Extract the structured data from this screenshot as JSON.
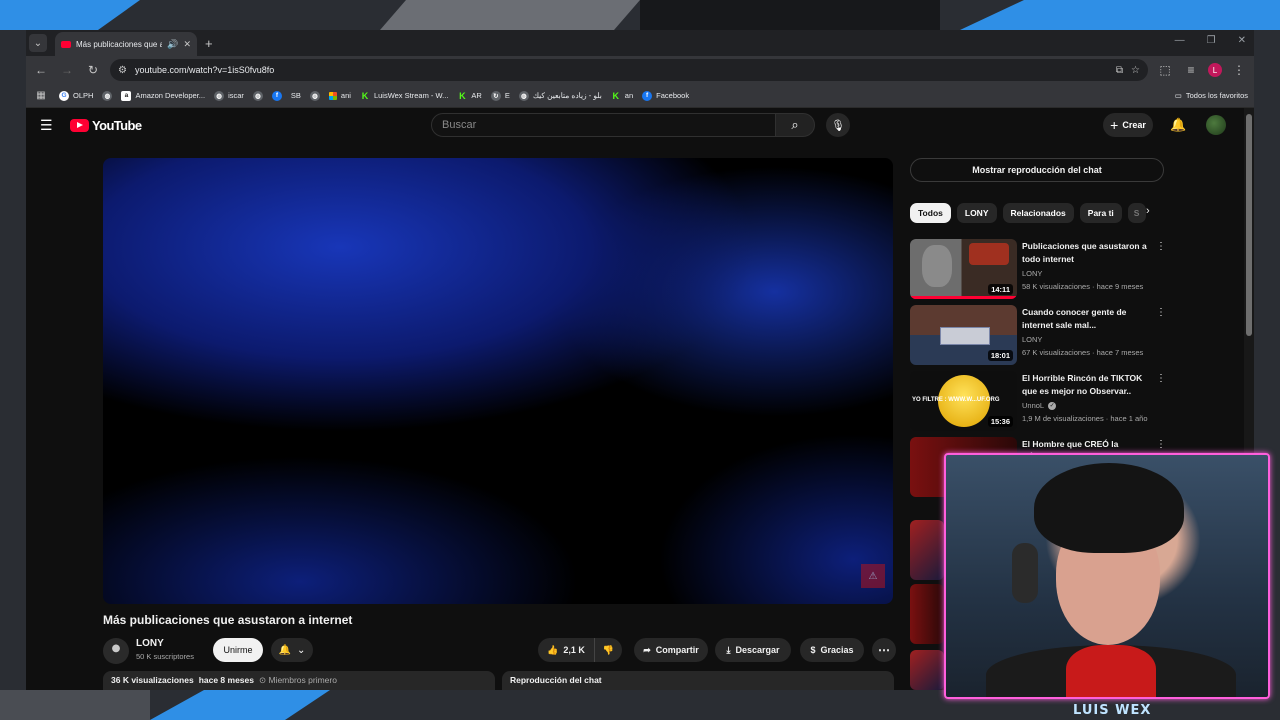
{
  "browser": {
    "tab": {
      "title": "Más publicaciones que asustaron a internet"
    },
    "url": "youtube.com/watch?v=1isS0fvu8fo",
    "profile_initial": "L",
    "bookmarks": [
      {
        "icon": "google-icon",
        "label": "OLPH"
      },
      {
        "icon": "globe-icon",
        "label": ""
      },
      {
        "icon": "amazon-icon",
        "label": "Amazon Developer..."
      },
      {
        "icon": "globe-icon",
        "label": "iscar"
      },
      {
        "icon": "globe-icon",
        "label": ""
      },
      {
        "icon": "facebook-icon",
        "label": ""
      },
      {
        "icon": "youtube-icon",
        "label": "SB"
      },
      {
        "icon": "globe-icon",
        "label": ""
      },
      {
        "icon": "microsoft-icon",
        "label": "ani"
      },
      {
        "icon": "kick-icon",
        "label": "LuisWex Stream - W..."
      },
      {
        "icon": "kick-icon",
        "label": "AR"
      },
      {
        "icon": "refresh-icon",
        "label": "E"
      },
      {
        "icon": "globe-icon",
        "label": "بلو - زياده متابعين كيك"
      },
      {
        "icon": "kick-icon",
        "label": "an"
      },
      {
        "icon": "facebook-icon",
        "label": "Facebook"
      }
    ],
    "all_bookmarks": "Todos los favoritos"
  },
  "youtube": {
    "logo_text": "YouTube",
    "search_placeholder": "Buscar",
    "create_label": "Crear",
    "video": {
      "title": "Más publicaciones que asustaron a internet",
      "channel": "LONY",
      "subscribers": "50 K suscriptores",
      "join_label": "Unirme",
      "likes": "2,1 K",
      "share_label": "Compartir",
      "download_label": "Descargar",
      "thanks_label": "Gracias",
      "views": "36 K visualizaciones",
      "age": "hace 8 meses",
      "members": "Miembros primero",
      "chat_replay_label": "Reproducción del chat"
    },
    "sidebar": {
      "chat_replay_button": "Mostrar reproducción del chat",
      "chips": [
        "Todos",
        "LONY",
        "Relacionados",
        "Para ti",
        "S"
      ],
      "recommendations": [
        {
          "title": "Publicaciones que asustaron a todo internet",
          "channel": "LONY",
          "meta": "58 K visualizaciones · hace 9 meses",
          "duration": "14:11",
          "verified": false
        },
        {
          "title": "Cuando conocer gente de internet sale mal...",
          "channel": "LONY",
          "meta": "67 K visualizaciones · hace 7 meses",
          "duration": "18:01",
          "verified": false
        },
        {
          "title": "El Horrible Rincón de TIKTOK que es mejor no Observar..",
          "channel": "UnnoL",
          "meta": "1,9 M de visualizaciones · hace 1 año",
          "duration": "15:36",
          "verified": true,
          "thumb_text": "YO FILTRE : WWW.W...UF.ORG"
        },
        {
          "title": "El Hombre que CREÓ la PÁGINA",
          "channel": "",
          "meta": "",
          "duration": "",
          "verified": false
        }
      ]
    }
  },
  "overlay": {
    "streamer_name": "LUIS WEX",
    "cam_border_color": "#ff5fdc",
    "accent_blue": "#2f8fe6"
  }
}
